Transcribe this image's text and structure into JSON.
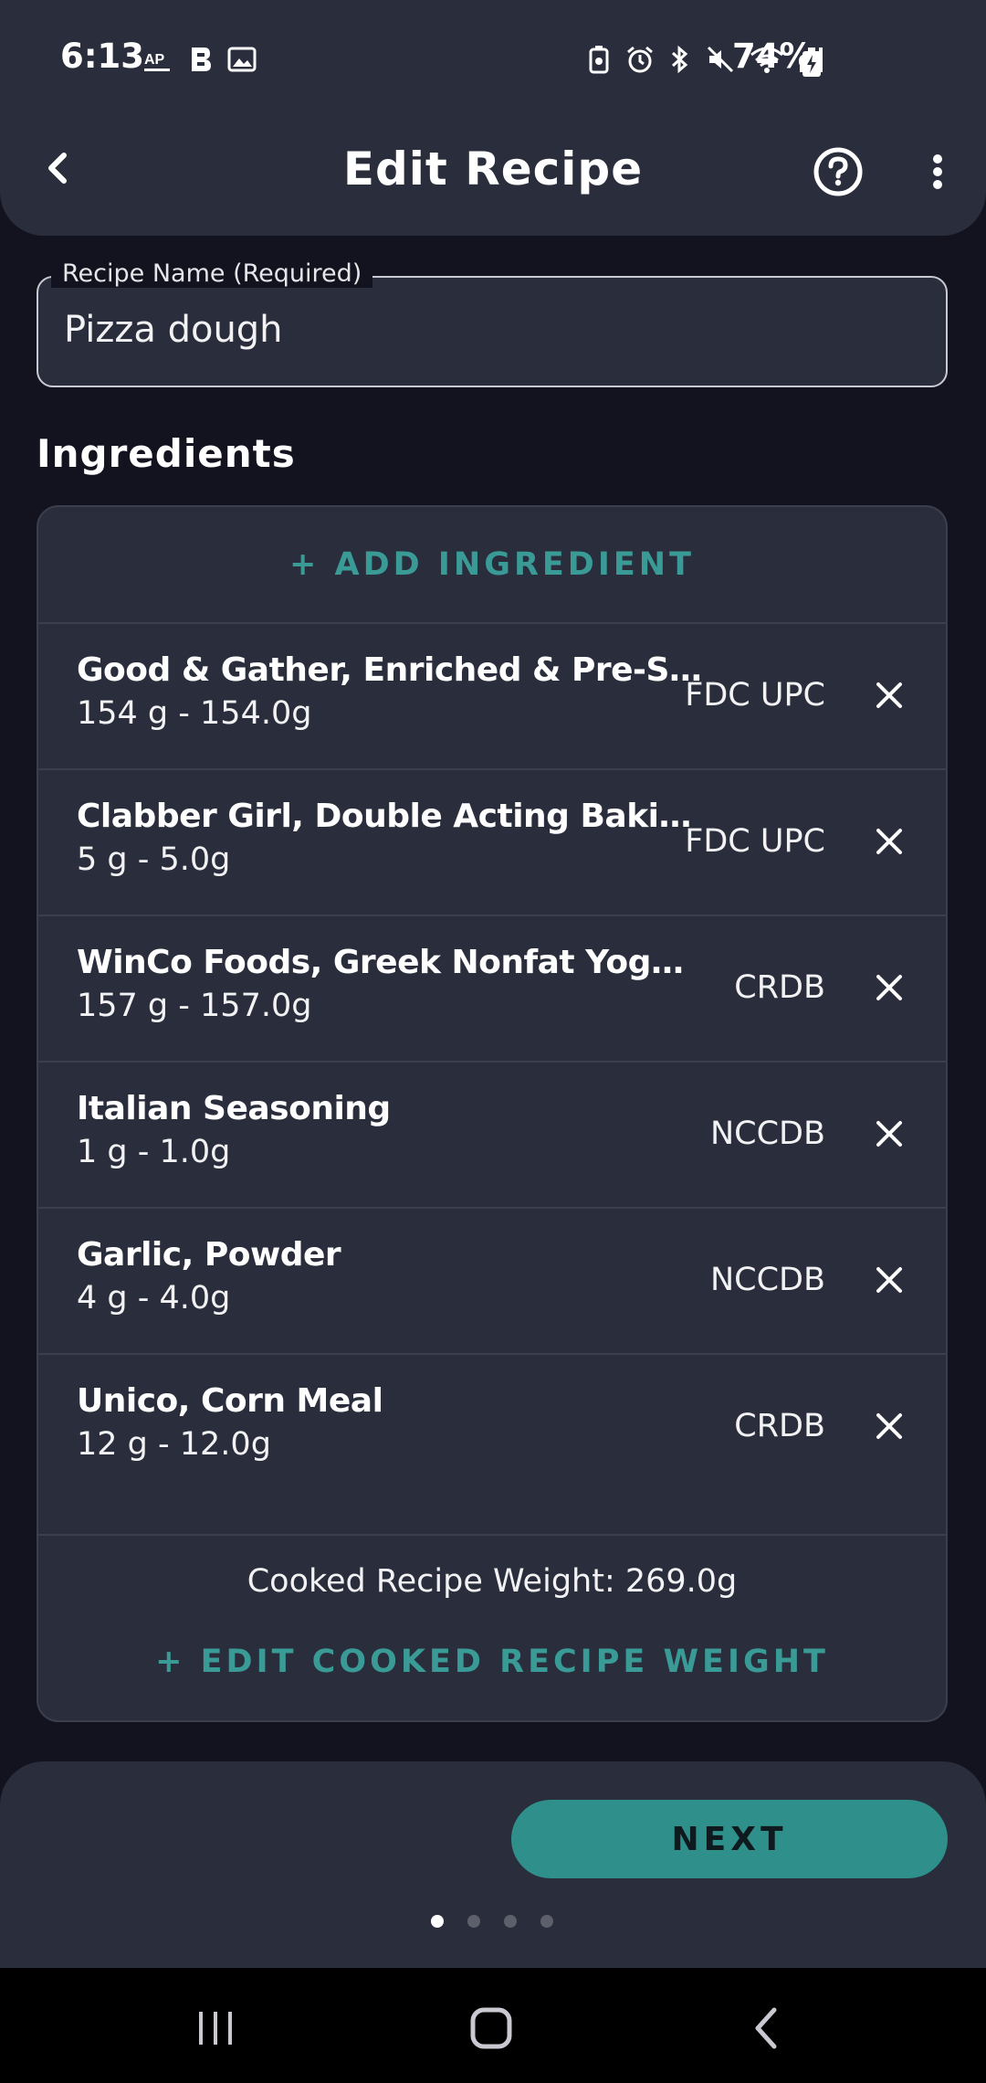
{
  "status_bar": {
    "time": "6:13",
    "left_icons": [
      "ap-news-icon",
      "b-app-icon",
      "image-icon"
    ],
    "right_icons": [
      "battery-saver-icon",
      "alarm-icon",
      "bluetooth-icon",
      "mute-icon",
      "wifi-icon",
      "signal-icon"
    ],
    "battery_percent": "74%"
  },
  "top_bar": {
    "title": "Edit Recipe"
  },
  "recipe_name": {
    "label": "Recipe Name (Required)",
    "value": "Pizza dough"
  },
  "ingredients_section": {
    "title": "Ingredients",
    "add_label": "+ ADD INGREDIENT",
    "items": [
      {
        "name": "Good & Gather, Enriched & Pre-Sifted …",
        "amount": "154 g - 154.0g",
        "source": "FDC UPC"
      },
      {
        "name": "Clabber Girl, Double Acting Baking Po…",
        "amount": "5 g - 5.0g",
        "source": "FDC UPC"
      },
      {
        "name": "WinCo Foods, Greek Nonfat Yogurt, Plain",
        "amount": "157 g - 157.0g",
        "source": "CRDB"
      },
      {
        "name": "Italian Seasoning",
        "amount": "1 g - 1.0g",
        "source": "NCCDB"
      },
      {
        "name": "Garlic, Powder",
        "amount": "4 g - 4.0g",
        "source": "NCCDB"
      },
      {
        "name": "Unico, Corn Meal",
        "amount": "12 g - 12.0g",
        "source": "CRDB"
      }
    ],
    "cooked_weight": "Cooked Recipe Weight: 269.0g",
    "edit_weight_label": "+ EDIT COOKED RECIPE WEIGHT"
  },
  "footer": {
    "next_label": "NEXT",
    "page_count": 4,
    "active_page": 1
  },
  "colors": {
    "accent": "#2f8f8b",
    "accent_text": "#3a9a96",
    "surface": "#2a2d3b",
    "background": "#13131f"
  }
}
